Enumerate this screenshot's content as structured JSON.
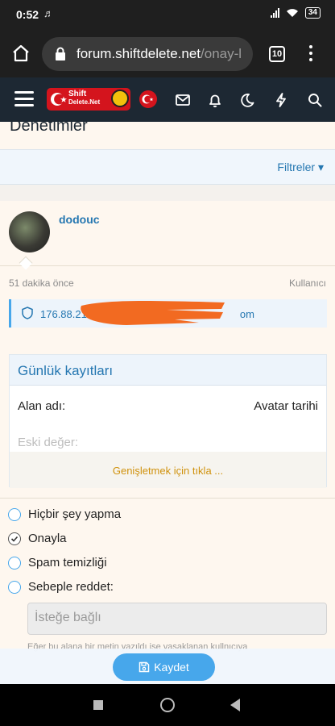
{
  "status_bar": {
    "time": "0:52",
    "note_icon": "music-note-icon",
    "battery": "34"
  },
  "browser": {
    "url_domain": "forum.shiftdelete.net",
    "url_rest": "/onay-l",
    "tab_count": "10"
  },
  "header": {
    "logo_line1": "Shift",
    "logo_line2": "Delete.Net",
    "icons": [
      "envelope-icon",
      "bell-icon",
      "moon-icon",
      "bolt-icon",
      "search-icon"
    ]
  },
  "page": {
    "title": "Denetimler",
    "filter_label": "Filtreler ▾"
  },
  "item": {
    "username": "dodouc",
    "time": "51 dakika önce",
    "kind": "Kullanıcı",
    "ip_prefix": "176.88.21",
    "ip_suffix": "om"
  },
  "log": {
    "title": "Günlük kayıtları",
    "field_label": "Alan adı:",
    "field_value": "Avatar tarihi",
    "old_value_label": "Eski değer:",
    "expand_label": "Genişletmek için tıkla ..."
  },
  "actions": {
    "options": [
      "Hiçbir şey yapma",
      "Onayla",
      "Spam temizliği",
      "Sebeple reddet:"
    ],
    "selected": "Onayla",
    "reason_placeholder": "İsteğe bağlı",
    "hint": "Eğer bu alana bir metin yazıldı ise yasaklanan kullnıcıya"
  },
  "save": {
    "label": "Kaydet"
  },
  "colors": {
    "accent": "#47a7eb",
    "link": "#2577b1",
    "header_bg": "#1d2833",
    "brand_red": "#d4141d",
    "expand": "#d0920e"
  }
}
